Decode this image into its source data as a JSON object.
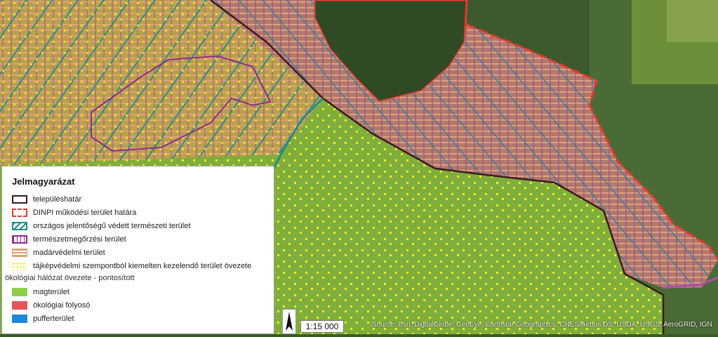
{
  "legend": {
    "title": "Jelmagyarázat",
    "items": [
      {
        "label": "településhatár",
        "color": "#3b1a1a"
      },
      {
        "label": "DINPI működési terület határa",
        "color": "#e8392b"
      },
      {
        "label": "országos jelentőségű védett természeti terület",
        "color": "#1f8f86"
      },
      {
        "label": "természetmegőrzési terület",
        "color": "#8e2a8e"
      },
      {
        "label": "madárvédelmi terület",
        "color": "#e2a07a"
      },
      {
        "label": "tájképvédelmi szempontból kiemelten kezelendő terület övezete",
        "color": "#f1ee1d"
      }
    ],
    "subheading": "ökológiai hálózat övezete - pontosított",
    "fill_items": [
      {
        "label": "magterület",
        "color": "#8fcf4a"
      },
      {
        "label": "ökológiai folyosó",
        "color": "#e8545a"
      },
      {
        "label": "pufferterület",
        "color": "#1e88d8"
      }
    ]
  },
  "scale": "1:15 000",
  "attribution": "Source: Esri, DigitalGlobe, GeoEye, Earthstar Geographics, CNES/Airbus DS, USDA, USGS, AeroGRID, IGN"
}
